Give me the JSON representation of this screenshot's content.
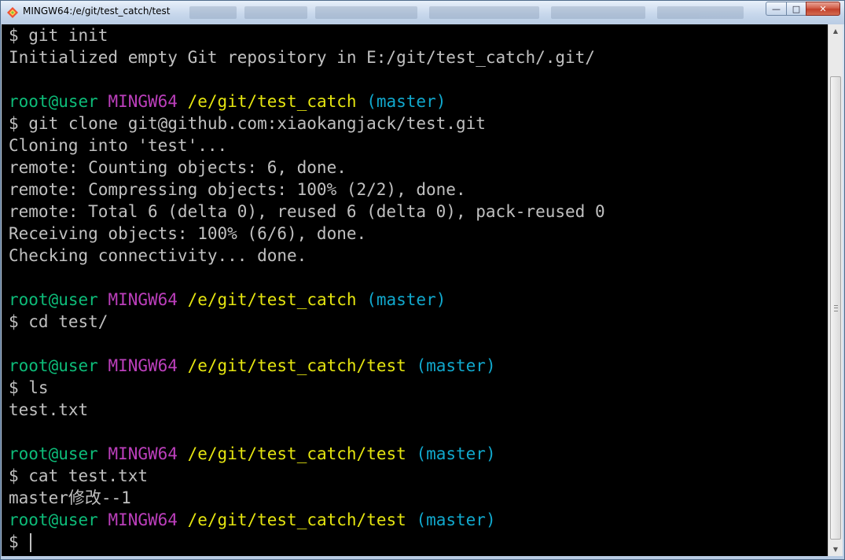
{
  "window": {
    "title": "MINGW64:/e/git/test_catch/test",
    "minimize_glyph": "—",
    "maximize_glyph": "□",
    "close_glyph": "✕"
  },
  "colors": {
    "user": "#0dbc79",
    "system": "#bc3fbc",
    "path": "#e5e510",
    "branch": "#11a8cd",
    "text": "#c0c0c0",
    "background": "#000000"
  },
  "prompts": [
    {
      "user": "root@user",
      "system": "MINGW64",
      "path": "/e/git/test_catch",
      "branch": "(master)"
    },
    {
      "user": "root@user",
      "system": "MINGW64",
      "path": "/e/git/test_catch",
      "branch": "(master)"
    },
    {
      "user": "root@user",
      "system": "MINGW64",
      "path": "/e/git/test_catch/test",
      "branch": "(master)"
    },
    {
      "user": "root@user",
      "system": "MINGW64",
      "path": "/e/git/test_catch/test",
      "branch": "(master)"
    },
    {
      "user": "root@user",
      "system": "MINGW64",
      "path": "/e/git/test_catch/test",
      "branch": "(master)"
    }
  ],
  "lines": [
    "$ git init",
    "Initialized empty Git repository in E:/git/test_catch/.git/",
    "",
    "$ git clone git@github.com:xiaokangjack/test.git",
    "Cloning into 'test'...",
    "remote: Counting objects: 6, done.",
    "remote: Compressing objects: 100% (2/2), done.",
    "remote: Total 6 (delta 0), reused 6 (delta 0), pack-reused 0",
    "Receiving objects: 100% (6/6), done.",
    "Checking connectivity... done.",
    "",
    "$ cd test/",
    "",
    "$ ls",
    "test.txt",
    "",
    "$ cat test.txt",
    "master修改--1",
    "$ "
  ],
  "icons": {
    "app": "git-bash-icon",
    "scroll_up": "up-arrow-icon",
    "scroll_down": "down-arrow-icon"
  }
}
